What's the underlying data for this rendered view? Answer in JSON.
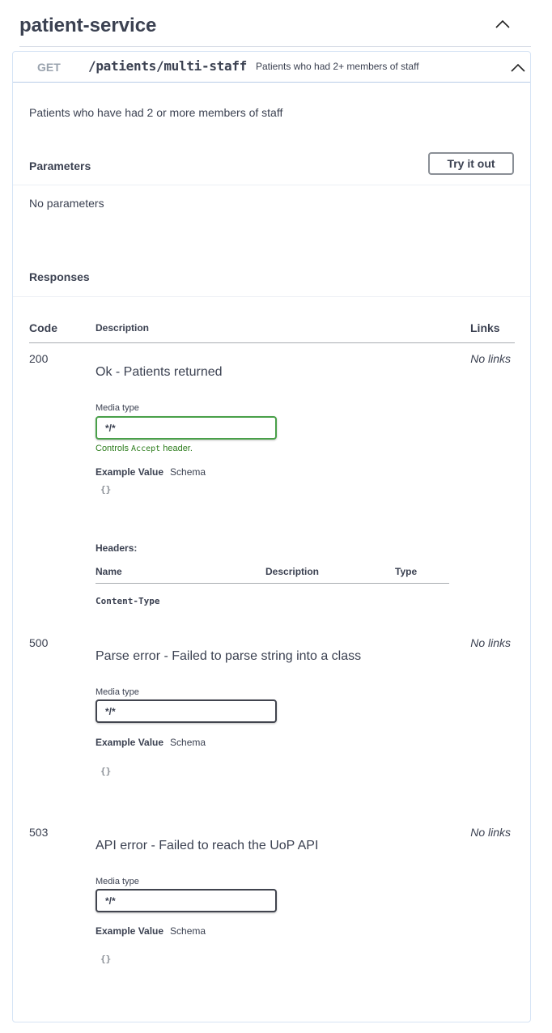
{
  "tag": {
    "title": "patient-service",
    "chevron_icon": "chevron-up-icon"
  },
  "operation": {
    "method": "GET",
    "path": "/patients/multi-staff",
    "summary": "Patients who had 2+ members of staff",
    "description": "Patients who have had 2 or more members of staff",
    "chevron_icon": "chevron-up-icon",
    "border_color": "#b9cde8"
  },
  "parameters": {
    "title": "Parameters",
    "try_button": "Try it out",
    "empty_text": "No parameters"
  },
  "responses": {
    "title": "Responses",
    "columns": {
      "code": "Code",
      "description": "Description",
      "links": "Links"
    },
    "items": [
      {
        "code": "200",
        "description": "Ok - Patients returned",
        "links": "No links",
        "media_label": "Media type",
        "media_type": "*/*",
        "controls_accept_prefix": "Controls",
        "controls_accept_code": "Accept",
        "controls_accept_suffix": "header.",
        "example_value": "Example Value",
        "schema": "Schema",
        "example": "{}",
        "headers": {
          "label": "Headers:",
          "col_name": "Name",
          "col_description": "Description",
          "col_type": "Type",
          "rows": [
            {
              "name": "Content-Type"
            }
          ]
        }
      },
      {
        "code": "500",
        "description": "Parse error - Failed to parse string into a class",
        "links": "No links",
        "media_label": "Media type",
        "media_type": "*/*",
        "example_value": "Example Value",
        "schema": "Schema",
        "example": "{}"
      },
      {
        "code": "503",
        "description": "API error - Failed to reach the UoP API",
        "links": "No links",
        "media_label": "Media type",
        "media_type": "*/*",
        "example_value": "Example Value",
        "schema": "Schema",
        "example": "{}"
      }
    ]
  },
  "colors": {
    "text": "#3b4151",
    "accept_green": "#2c7c1c",
    "active_border": "#49a049"
  }
}
